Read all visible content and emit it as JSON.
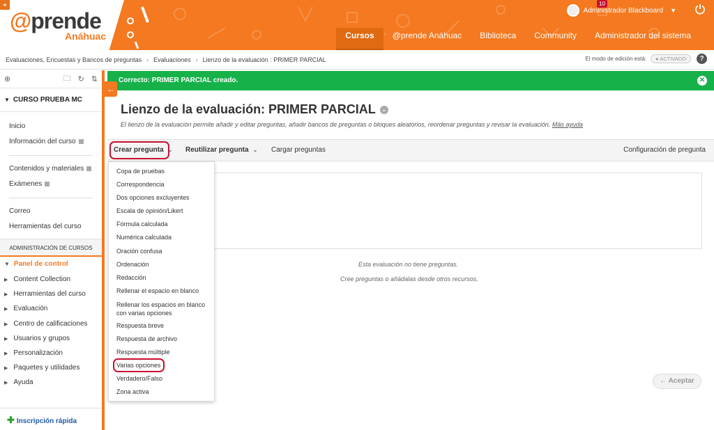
{
  "header": {
    "logo_main_at": "@",
    "logo_main_rest": "prende",
    "logo_sub": "Anáhuac",
    "nav": [
      "Cursos",
      "@prende Anáhuac",
      "Biblioteca",
      "Community",
      "Administrador del sistema"
    ],
    "active_nav": "Cursos",
    "user_name": "Administrador Blackboard",
    "notification_count": "10"
  },
  "breadcrumb": {
    "items": [
      "Evaluaciones, Encuestas y Bancos de preguntas",
      "Evaluaciones",
      "Lienzo de la evaluación : PRIMER PARCIAL"
    ],
    "edit_mode_label": "El modo de edición está:",
    "edit_mode_value": "● ACTIVADO",
    "help": "?"
  },
  "sidebar": {
    "course_title": "CURSO PRUEBA MC",
    "links1": [
      "Inicio",
      "Información del curso"
    ],
    "links2": [
      "Contenidos y materiales",
      "Exámenes"
    ],
    "links3": [
      "Correo",
      "Herramientas del curso"
    ],
    "admin_title": "ADMINISTRACIÓN DE CURSOS",
    "panel_title": "Panel de control",
    "panel_items": [
      "Content Collection",
      "Herramientas del curso",
      "Evaluación",
      "Centro de calificaciones",
      "Usuarios y grupos",
      "Personalización",
      "Paquetes y utilidades",
      "Ayuda"
    ],
    "quick_enroll": "Inscripción rápida"
  },
  "main": {
    "success_message": "Correcto: PRIMER PARCIAL creado.",
    "title": "Lienzo de la evaluación: PRIMER PARCIAL",
    "description": "El lienzo de la evaluación permite añadir y editar preguntas, añadir bancos de preguntas o bloques aleatorios, reordenar preguntas y revisar la evaluación.",
    "more_help": "Más ayuda",
    "toolbar": {
      "create": "Crear pregunta",
      "reuse": "Reutilizar pregunta",
      "upload": "Cargar preguntas",
      "settings": "Configuración de pregunta"
    },
    "empty_line1": "Esta evaluación no tiene preguntas.",
    "empty_line2": "Cree preguntas o añádalas desde otros recursos.",
    "accept": "← Aceptar"
  },
  "question_types": [
    "Copa de pruebas",
    "Correspondencia",
    "Dos opciones excluyentes",
    "Escala de opinión/Likert",
    "Fórmula calculada",
    "Numérica calculada",
    "Oración confusa",
    "Ordenación",
    "Redacción",
    "Rellenar el espacio en blanco",
    "Rellenar los espacios en blanco con varias opciones",
    "Respuesta breve",
    "Respuesta de archivo",
    "Respuesta múltiple",
    "Varias opciones",
    "Verdadero/Falso",
    "Zona activa"
  ],
  "colors": {
    "brand_orange": "#f47920",
    "success_green": "#17b14a",
    "highlight_red": "#c8102e",
    "link_blue": "#1e5aa8"
  }
}
